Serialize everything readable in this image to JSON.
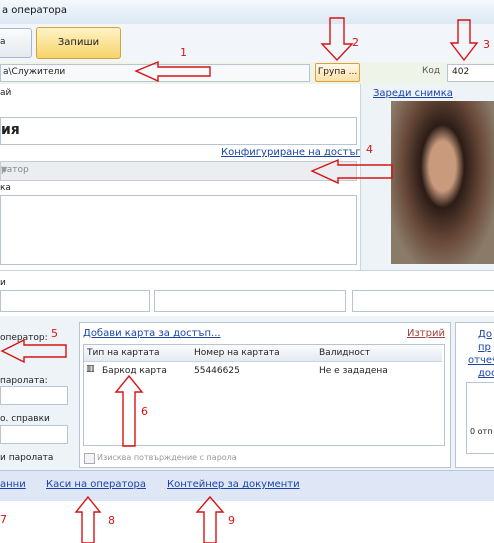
{
  "window": {
    "title": "а оператора"
  },
  "toolbar": {
    "left_button_label": "а",
    "save_label": "Запиши"
  },
  "path": {
    "value": "а\\Служители"
  },
  "group_button": {
    "label": "Група ..."
  },
  "code": {
    "label": "Код",
    "value": "402"
  },
  "details": {
    "section1_label": "ай",
    "name_value": "ия",
    "access_link": "Конфигуриране на достъпа",
    "type_value": "ратор",
    "notes_label": "ка"
  },
  "photo": {
    "load_link": "Зареди снимка"
  },
  "contacts": {
    "label": "и"
  },
  "left_labels": {
    "operator": "оператор:",
    "password": "паролата:",
    "reports": "о. справки",
    "password2": "и паролата"
  },
  "cards": {
    "add_link": "Добави карта за достъп...",
    "delete_link": "Изтрий",
    "columns": [
      "Тип на картата",
      "Номер на картата",
      "Валидност"
    ],
    "rows": [
      {
        "type": "Баркод карта",
        "number": "55446625",
        "validity": "Не е зададена"
      }
    ],
    "require_password": "Изисква потвърждение с парола"
  },
  "right_panel": {
    "lines": [
      "До",
      "пр",
      "отчеч",
      "дос"
    ],
    "count": "0 отп"
  },
  "bottom": {
    "link_data": "анни",
    "link_cash": "Каси на оператора",
    "link_docs": "Контейнер за документи"
  },
  "annotations": {
    "n1": "1",
    "n2": "2",
    "n3": "3",
    "n4": "4",
    "n5": "5",
    "n6": "6",
    "n7": "7",
    "n8": "8",
    "n9": "9"
  },
  "colors": {
    "annotation": "#d51414",
    "link": "#1a44a8",
    "save_button": "#f7d36b"
  }
}
